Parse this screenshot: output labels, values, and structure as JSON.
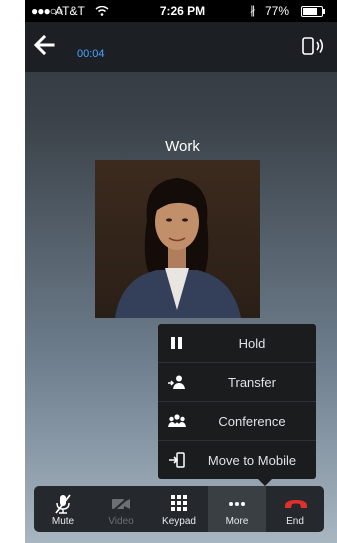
{
  "status_bar": {
    "signal": "●●●○○",
    "carrier": "AT&T",
    "time": "7:26 PM",
    "bluetooth": "∦",
    "battery_percent": "77%",
    "battery_level": 0.77
  },
  "nav": {
    "call_duration": "00:04",
    "back_icon": "arrow-left-icon",
    "audio_icon": "phone-speaker-icon"
  },
  "contact": {
    "name": "Work"
  },
  "more_menu": {
    "items": [
      {
        "label": "Hold",
        "icon": "pause-icon"
      },
      {
        "label": "Transfer",
        "icon": "transfer-icon"
      },
      {
        "label": "Conference",
        "icon": "conference-icon"
      },
      {
        "label": "Move to Mobile",
        "icon": "move-to-mobile-icon"
      }
    ]
  },
  "toolbar": {
    "buttons": [
      {
        "label": "Mute",
        "icon": "mic-muted-icon",
        "enabled": true
      },
      {
        "label": "Video",
        "icon": "video-off-icon",
        "enabled": false
      },
      {
        "label": "Keypad",
        "icon": "keypad-icon",
        "enabled": true
      },
      {
        "label": "More",
        "icon": "more-dots-icon",
        "enabled": true,
        "active": true
      },
      {
        "label": "End",
        "icon": "end-call-icon",
        "enabled": true
      }
    ]
  },
  "colors": {
    "accent": "#4aa3ff",
    "end_call": "#e0302c",
    "menu_bg": "#1a1c1e"
  }
}
